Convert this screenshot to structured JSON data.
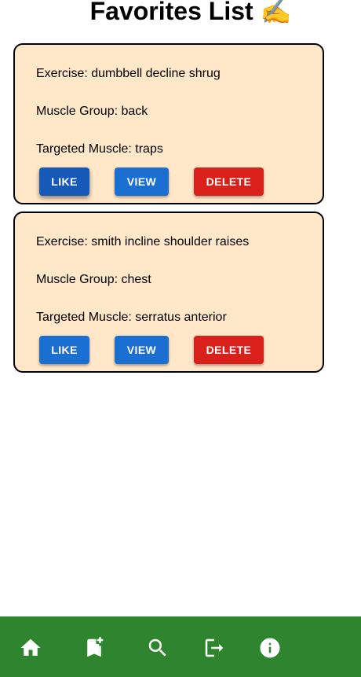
{
  "page": {
    "title": "Favorites List ✍"
  },
  "cards": [
    {
      "exercise_label": "Exercise: dumbbell decline shrug",
      "muscle_group_label": "Muscle Group: back",
      "targeted_muscle_label": "Targeted Muscle: traps",
      "like_label": "LIKE",
      "view_label": "VIEW",
      "delete_label": "DELETE"
    },
    {
      "exercise_label": "Exercise: smith incline shoulder raises",
      "muscle_group_label": "Muscle Group: chest",
      "targeted_muscle_label": "Targeted Muscle: serratus anterior",
      "like_label": "LIKE",
      "view_label": "VIEW",
      "delete_label": "DELETE"
    }
  ],
  "nav": {
    "items": [
      {
        "icon": "home-icon"
      },
      {
        "icon": "bookmark-add-icon"
      },
      {
        "icon": "search-icon"
      },
      {
        "icon": "logout-icon"
      },
      {
        "icon": "info-icon"
      }
    ]
  },
  "colors": {
    "card_background": "#ffe7c8",
    "card_border": "#000000",
    "like_button": "#1a6fd0",
    "like_button_active": "#1759b6",
    "view_button": "#1a6fd0",
    "delete_button": "#d9201a",
    "nav_background": "#2f852f",
    "nav_icon": "#ffffff"
  }
}
